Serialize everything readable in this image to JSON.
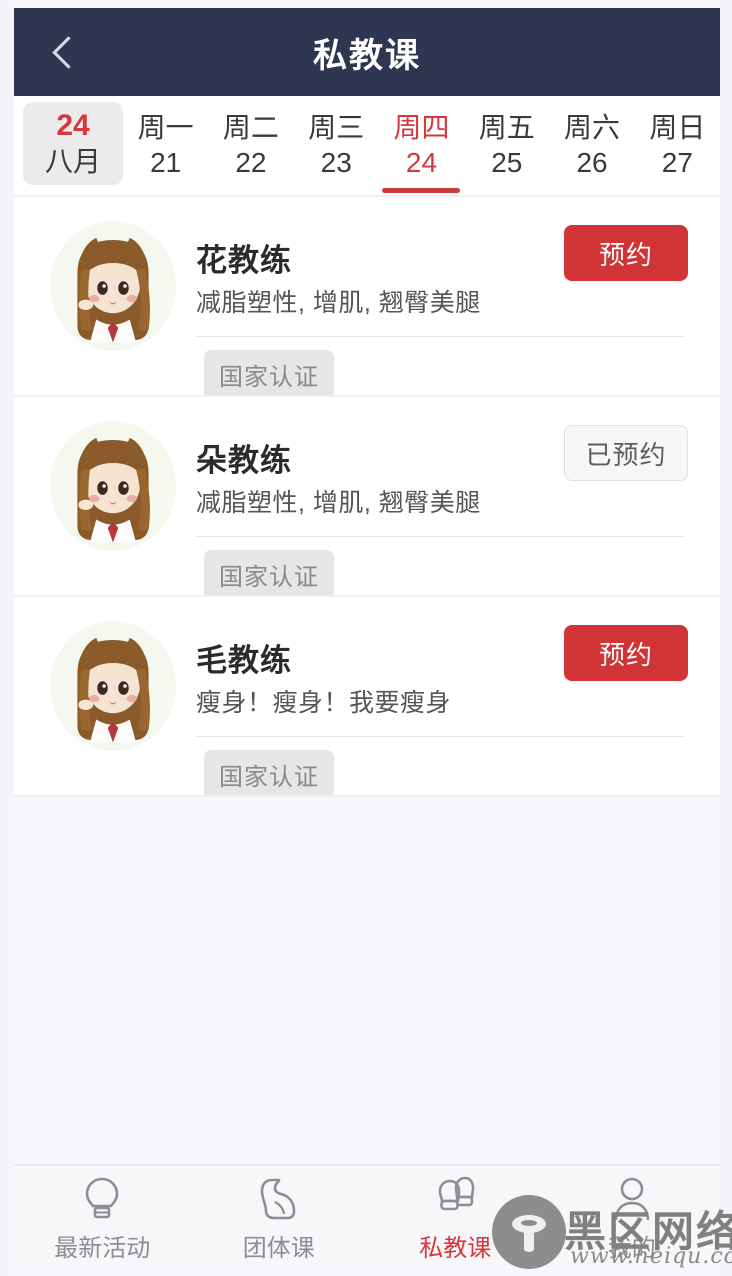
{
  "header": {
    "title": "私教课",
    "back_icon": "chevron-left-icon",
    "bg_color": "#2e3651"
  },
  "date_strip": {
    "today_chip": {
      "day": "24",
      "month": "八月"
    },
    "days": [
      {
        "dow": "周一",
        "num": "21",
        "selected": false
      },
      {
        "dow": "周二",
        "num": "22",
        "selected": false
      },
      {
        "dow": "周三",
        "num": "23",
        "selected": false
      },
      {
        "dow": "周四",
        "num": "24",
        "selected": true
      },
      {
        "dow": "周五",
        "num": "25",
        "selected": false
      },
      {
        "dow": "周六",
        "num": "26",
        "selected": false
      },
      {
        "dow": "周日",
        "num": "27",
        "selected": false
      }
    ],
    "accent_color": "#d6393c"
  },
  "coaches": [
    {
      "name": "花教练",
      "specialties": "减脂塑性, 增肌, 翘臀美腿",
      "certification": "国家认证",
      "action_label": "预约",
      "booked": false
    },
    {
      "name": "朵教练",
      "specialties": "减脂塑性, 增肌, 翘臀美腿",
      "certification": "国家认证",
      "action_label": "已预约",
      "booked": true
    },
    {
      "name": "毛教练",
      "specialties": "瘦身！瘦身！我要瘦身",
      "certification": "国家认证",
      "action_label": "预约",
      "booked": false
    }
  ],
  "tabbar": {
    "items": [
      {
        "label": "最新活动",
        "icon": "lightbulb-icon",
        "active": false
      },
      {
        "label": "团体课",
        "icon": "flexed-biceps-icon",
        "active": false
      },
      {
        "label": "私教课",
        "icon": "boxing-gloves-icon",
        "active": true
      },
      {
        "label": "我的",
        "icon": "person-icon",
        "active": false
      }
    ],
    "active_color": "#d6393c",
    "inactive_color": "#8d8d93"
  },
  "watermark": {
    "brand": "黑区网络",
    "url": "www.heiqu.com"
  }
}
